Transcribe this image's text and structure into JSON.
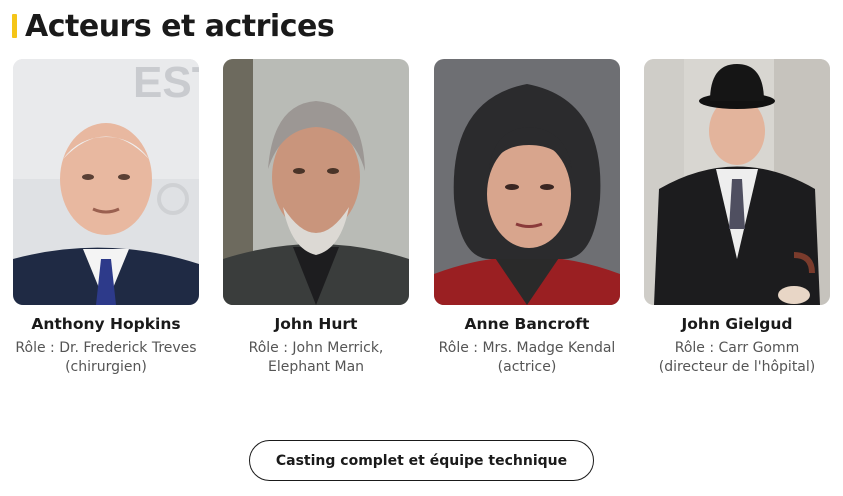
{
  "section": {
    "title": "Acteurs et actrices",
    "accent_color": "#f5c518"
  },
  "cast": [
    {
      "name": "Anthony Hopkins",
      "role": "Rôle : Dr. Frederick Treves (chirurgien)"
    },
    {
      "name": "John Hurt",
      "role": "Rôle : John Merrick, Elephant Man"
    },
    {
      "name": "Anne Bancroft",
      "role": "Rôle : Mrs. Madge Kendal (actrice)"
    },
    {
      "name": "John Gielgud",
      "role": "Rôle : Carr Gomm (directeur de l'hôpital)"
    }
  ],
  "full_cast_button": {
    "label": "Casting complet et équipe technique"
  }
}
